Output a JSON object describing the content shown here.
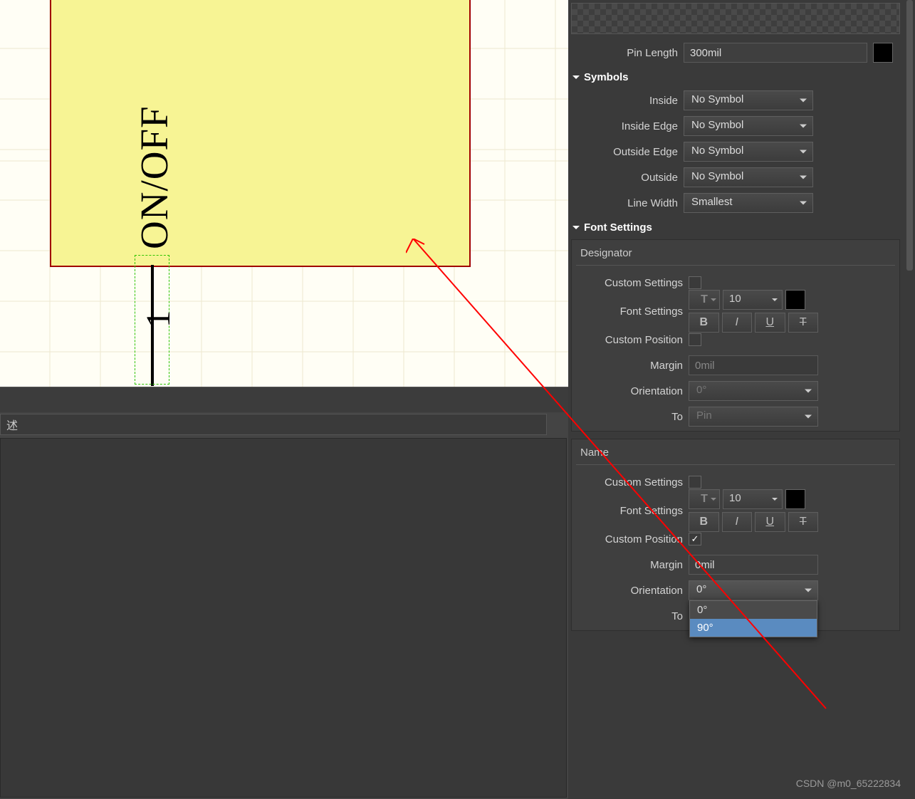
{
  "canvas": {
    "pin_name": "ON/OFF",
    "pin_number": "1"
  },
  "desc_panel": {
    "tab_label": "述"
  },
  "props": {
    "pin_length_label": "Pin Length",
    "pin_length_value": "300mil",
    "symbols_header": "Symbols",
    "inside_label": "Inside",
    "inside_value": "No Symbol",
    "inside_edge_label": "Inside Edge",
    "inside_edge_value": "No Symbol",
    "outside_edge_label": "Outside Edge",
    "outside_edge_value": "No Symbol",
    "outside_label": "Outside",
    "outside_value": "No Symbol",
    "line_width_label": "Line Width",
    "line_width_value": "Smallest",
    "font_settings_header": "Font Settings",
    "designator_header": "Designator",
    "name_header": "Name",
    "custom_settings_label": "Custom Settings",
    "font_settings_label": "Font Settings",
    "font_size_value": "10",
    "custom_position_label": "Custom Position",
    "margin_label": "Margin",
    "margin_value_disabled": "0mil",
    "margin_value_enabled": "0mil",
    "orientation_label": "Orientation",
    "orientation_value_disabled": "0°",
    "orientation_value_enabled": "0°",
    "to_label": "To",
    "to_value": "Pin",
    "dd_options": {
      "opt0": "0°",
      "opt90": "90°"
    }
  },
  "watermark": "CSDN @m0_65222834"
}
